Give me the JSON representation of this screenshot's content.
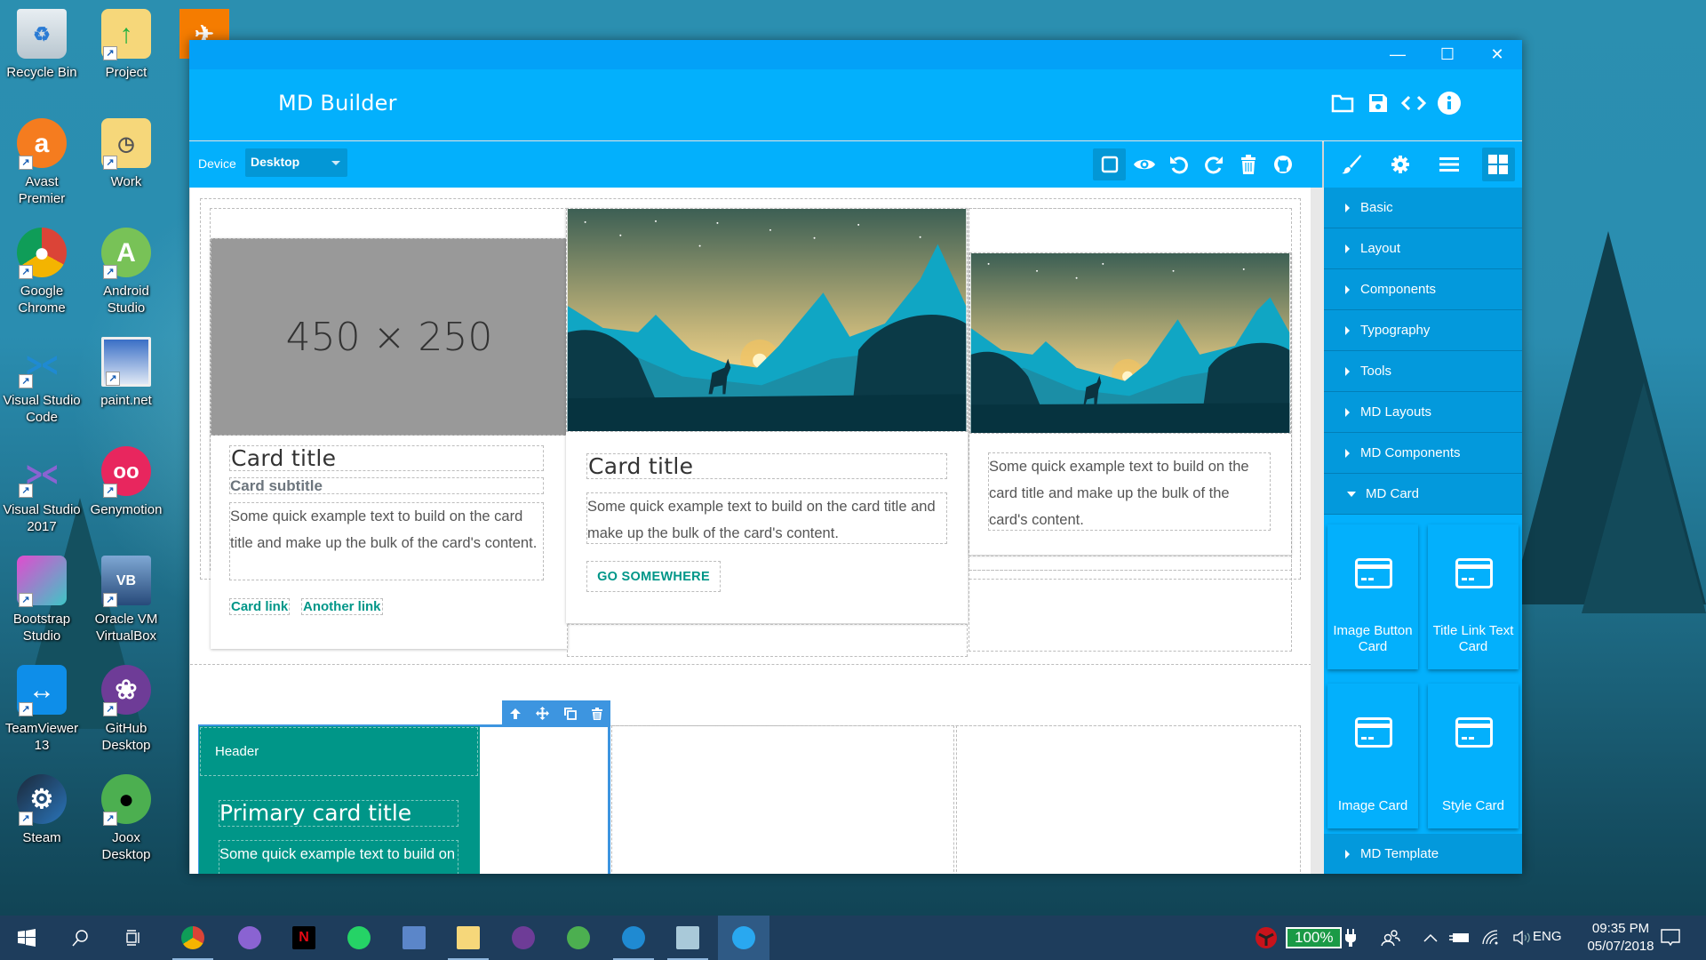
{
  "desktop": {
    "icons": [
      {
        "label": "Recycle Bin",
        "icon": "recycle-bin-icon"
      },
      {
        "label": "Project",
        "icon": "folder-upload-icon"
      },
      {
        "label": "Avast Premier",
        "icon": "avast-icon"
      },
      {
        "label": "Work",
        "icon": "folder-clock-icon"
      },
      {
        "label": "Google Chrome",
        "icon": "chrome-icon"
      },
      {
        "label": "Android Studio",
        "icon": "android-studio-icon"
      },
      {
        "label": "Visual Studio Code",
        "icon": "vscode-icon"
      },
      {
        "label": "paint.net",
        "icon": "paint-net-icon"
      },
      {
        "label": "Visual Studio 2017",
        "icon": "visual-studio-icon"
      },
      {
        "label": "Genymotion",
        "icon": "genymotion-icon"
      },
      {
        "label": "Bootstrap Studio",
        "icon": "bootstrap-studio-icon"
      },
      {
        "label": "Oracle VM VirtualBox",
        "icon": "virtualbox-icon"
      },
      {
        "label": "TeamViewer 13",
        "icon": "teamviewer-icon"
      },
      {
        "label": "GitHub Desktop",
        "icon": "github-desktop-icon"
      },
      {
        "label": "Steam",
        "icon": "steam-icon"
      },
      {
        "label": "Joox Desktop",
        "icon": "joox-icon"
      }
    ]
  },
  "window": {
    "title": "MD Builder",
    "controls": {
      "minimize": "—",
      "maximize": "☐",
      "close": "✕"
    }
  },
  "appbar": {
    "actions": [
      "open-folder-icon",
      "save-icon",
      "code-icon",
      "info-icon"
    ]
  },
  "toolbar": {
    "device_label": "Device",
    "device_value": "Desktop",
    "tools": [
      "outline-toggle-icon",
      "preview-eye-icon",
      "undo-icon",
      "redo-icon",
      "trash-icon",
      "github-icon"
    ],
    "panel_tabs": [
      "brush-icon",
      "gear-icon",
      "menu-icon",
      "grid-icon"
    ]
  },
  "canvas": {
    "row1": {
      "card1": {
        "placeholder": "450 × 250",
        "title": "Card title",
        "subtitle": "Card subtitle",
        "text": "Some quick example text to build on the card title and make up the bulk of the card's content.",
        "links": [
          "Card link",
          "Another link"
        ]
      },
      "card2": {
        "title": "Card title",
        "text": "Some quick example text to build on the card title and make up the bulk of the card's content.",
        "button": "GO SOMEWHERE"
      },
      "card3": {
        "text": "Some quick example text to build on the card title and make up the bulk of the card's content."
      }
    },
    "row2": {
      "teal_card": {
        "header": "Header",
        "title": "Primary card title",
        "text": "Some quick example text to build on the card title and make up the bulk of the card's content."
      },
      "selection_tools": [
        "arrow-up-icon",
        "move-icon",
        "copy-icon",
        "delete-icon"
      ]
    }
  },
  "panel": {
    "sections": [
      {
        "label": "Basic",
        "expanded": false
      },
      {
        "label": "Layout",
        "expanded": false
      },
      {
        "label": "Components",
        "expanded": false
      },
      {
        "label": "Typography",
        "expanded": false
      },
      {
        "label": "Tools",
        "expanded": false
      },
      {
        "label": "MD Layouts",
        "expanded": false
      },
      {
        "label": "MD Components",
        "expanded": false
      },
      {
        "label": "MD Card",
        "expanded": true
      },
      {
        "label": "MD Template",
        "expanded": false
      }
    ],
    "md_card_items": [
      "Image Button Card",
      "Title Link Text Card",
      "Image Card",
      "Style Card"
    ]
  },
  "taskbar": {
    "apps": [
      "start-icon",
      "search-icon",
      "task-view-icon",
      "chrome-icon",
      "visual-studio-icon",
      "netflix-icon",
      "whatsapp-icon",
      "paint-net-icon",
      "file-explorer-icon",
      "github-desktop-icon",
      "joox-icon",
      "vscode-icon",
      "notepad-icon",
      "md-builder-icon"
    ],
    "battery_percent": "100%",
    "language": "ENG",
    "time": "09:35 PM",
    "date": "05/07/2018"
  },
  "colors": {
    "accent": "#03b0fc",
    "titlebar": "#03a1f7",
    "panel": "#0399dc",
    "teal": "#009688",
    "selection": "#3d95e0"
  }
}
